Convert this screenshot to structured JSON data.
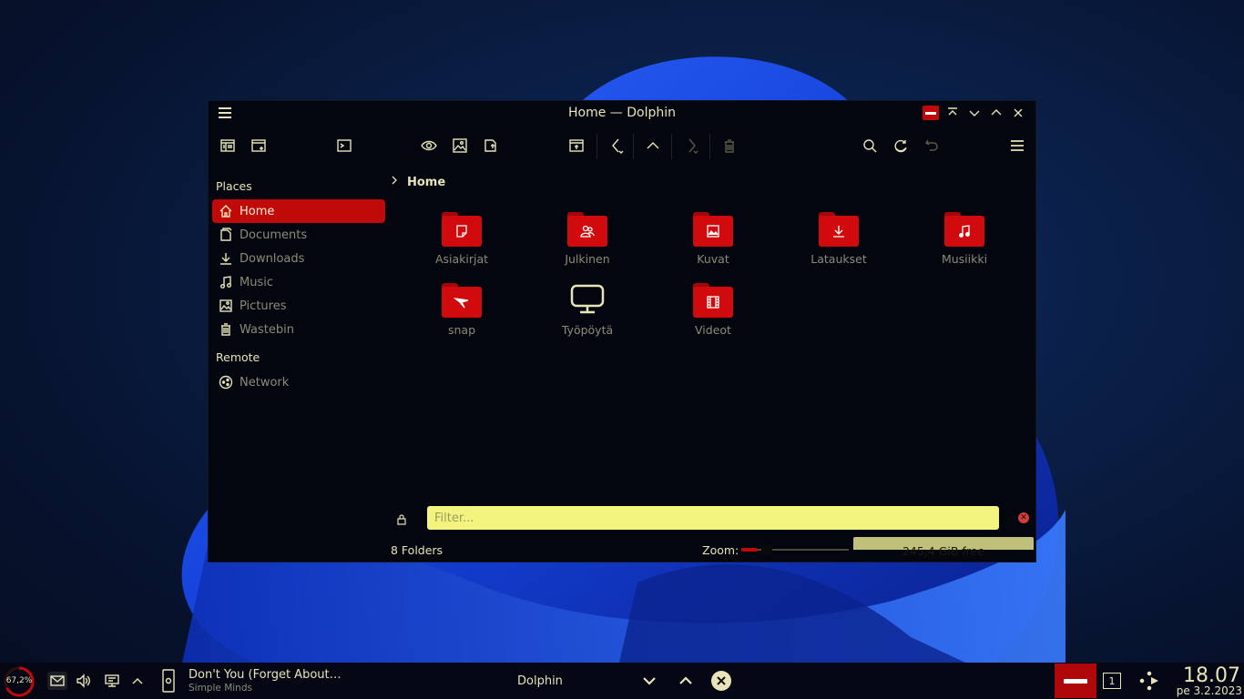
{
  "window": {
    "title": "Home — Dolphin"
  },
  "sidebar": {
    "sections": [
      {
        "title": "Places",
        "items": [
          {
            "label": "Home",
            "icon": "home-icon",
            "active": true
          },
          {
            "label": "Documents",
            "icon": "documents-icon"
          },
          {
            "label": "Downloads",
            "icon": "downloads-icon"
          },
          {
            "label": "Music",
            "icon": "music-icon"
          },
          {
            "label": "Pictures",
            "icon": "pictures-icon"
          },
          {
            "label": "Wastebin",
            "icon": "wastebin-icon"
          }
        ]
      },
      {
        "title": "Remote",
        "items": [
          {
            "label": "Network",
            "icon": "network-icon"
          }
        ]
      }
    ]
  },
  "breadcrumb": {
    "current": "Home"
  },
  "folders": [
    {
      "name": "Asiakirjat",
      "icon": "document-folder-icon"
    },
    {
      "name": "Julkinen",
      "icon": "public-folder-icon"
    },
    {
      "name": "Kuvat",
      "icon": "pictures-folder-icon"
    },
    {
      "name": "Lataukset",
      "icon": "downloads-folder-icon"
    },
    {
      "name": "Musiikki",
      "icon": "music-folder-icon"
    },
    {
      "name": "snap",
      "icon": "snap-folder-icon"
    },
    {
      "name": "Työpöytä",
      "icon": "desktop-monitor-icon"
    },
    {
      "name": "Videot",
      "icon": "videos-folder-icon"
    }
  ],
  "filter": {
    "placeholder": "Filter..."
  },
  "statusbar": {
    "count": "8 Folders",
    "zoom_label": "Zoom:",
    "zoom_level": 0.15,
    "free_space": "245,4 GiB free"
  },
  "taskbar": {
    "cpu": "67,2%",
    "cpu_level": 0.672,
    "media_title": "Don't You (Forget About…",
    "media_artist": "Simple Minds",
    "task_label": "Dolphin",
    "desktop_number": "1",
    "time": "18.07",
    "date": "pe 3.2.2023"
  },
  "colors": {
    "accent": "#c00a0a",
    "text": "#e8e3b8",
    "filter_bg": "#f3f47d"
  }
}
